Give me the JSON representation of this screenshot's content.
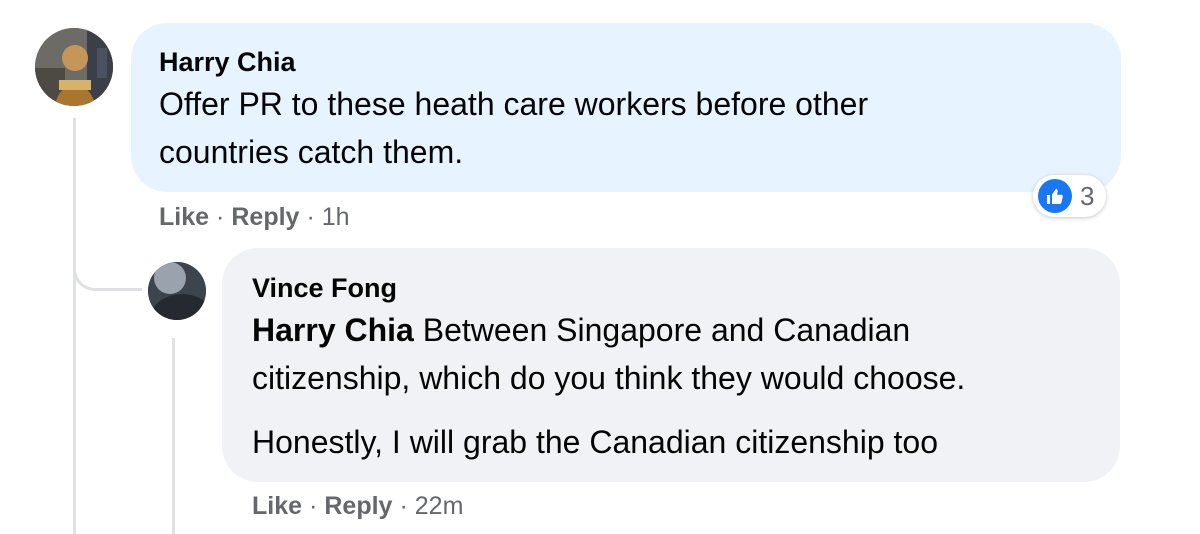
{
  "comment": {
    "author": "Harry Chia",
    "text_line_1": "Offer PR to these heath care workers before other",
    "text_line_2": "countries catch them.",
    "like_label": "Like",
    "reply_label": "Reply",
    "separator": "·",
    "timestamp": "1h",
    "reaction_count": "3",
    "reaction_icon": "thumbs-up-icon",
    "bubble_color": "#e7f3ff"
  },
  "reply": {
    "author": "Vince Fong",
    "mention": "Harry Chia",
    "text_line_1": "Between Singapore and Canadian",
    "text_line_2": "citizenship, which do you think they would choose.",
    "text_para_2": "Honestly, I will grab the Canadian citizenship too",
    "like_label": "Like",
    "reply_label": "Reply",
    "separator": "·",
    "timestamp": "22m",
    "bubble_color": "#f0f2f5"
  },
  "colors": {
    "accent": "#1877f2",
    "meta_text": "#65676b",
    "thread_line": "#dfe1e5"
  }
}
